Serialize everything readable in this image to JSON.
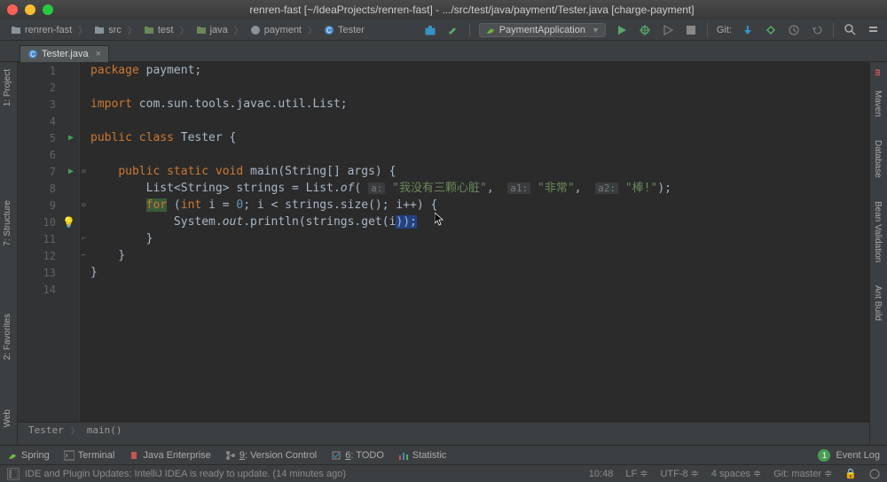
{
  "titlebar": {
    "title": "renren-fast [~/IdeaProjects/renren-fast] - .../src/test/java/payment/Tester.java [charge-payment]"
  },
  "breadcrumbs": [
    "renren-fast",
    "src",
    "test",
    "java",
    "payment",
    "Tester"
  ],
  "toolbar": {
    "run_config": "PaymentApplication",
    "git_label": "Git:"
  },
  "tabs": [
    {
      "label": "Tester.java"
    }
  ],
  "left_tools": [
    "1: Project",
    "7: Structure",
    "2: Favorites",
    "Web"
  ],
  "right_tools": [
    "Maven",
    "Database",
    "Bean Validation",
    "Ant Build"
  ],
  "gutter": {
    "lines": [
      1,
      2,
      3,
      4,
      5,
      6,
      7,
      8,
      9,
      10,
      11,
      12,
      13,
      14
    ],
    "run_markers": [
      5,
      7
    ],
    "bulb_line": 10
  },
  "code": {
    "l1_kw": "package",
    "l1_rest": " payment;",
    "l3_kw": "import",
    "l3_rest": " com.sun.tools.javac.util.List;",
    "l5_kw": "public class ",
    "l5_name": "Tester {",
    "l7_kw1": "public static void ",
    "l7_name": "main",
    "l7_rest": "(String[] args) {",
    "l8_indent": "        List<String> strings = List.",
    "l8_it": "of",
    "l8_open": "( ",
    "l8_h1": "a:",
    "l8_s1": "\"我没有三颗心脏\"",
    "l8_c1": ",  ",
    "l8_h2": "a1:",
    "l8_s2": "\"非常\"",
    "l8_c2": ",  ",
    "l8_h3": "a2:",
    "l8_s3": "\"棒!\"",
    "l8_close": ");",
    "l9_indent": "        ",
    "l9_kw": "for",
    "l9_rest1": " (",
    "l9_kw2": "int",
    "l9_rest2": " i = ",
    "l9_n0": "0",
    "l9_rest3": "; i < strings.size(); i++) {",
    "l10_indent": "            System.",
    "l10_it": "out",
    "l10_rest": ".println(strings.get(i",
    "l10_close": "));",
    "l11": "        }",
    "l12": "    }",
    "l13": "}"
  },
  "editor_crumb": [
    "Tester",
    "main()"
  ],
  "bottombar": {
    "items": [
      "Spring",
      "Terminal",
      "Java Enterprise",
      "9: Version Control",
      "6: TODO",
      "Statistic"
    ],
    "event_log": "Event Log",
    "event_count": "1"
  },
  "statusbar": {
    "msg": "IDE and Plugin Updates: IntelliJ IDEA is ready to update. (14 minutes ago)",
    "pos": "10:48",
    "le": "LF",
    "enc": "UTF-8",
    "indent": "4 spaces",
    "git": "Git: master"
  }
}
